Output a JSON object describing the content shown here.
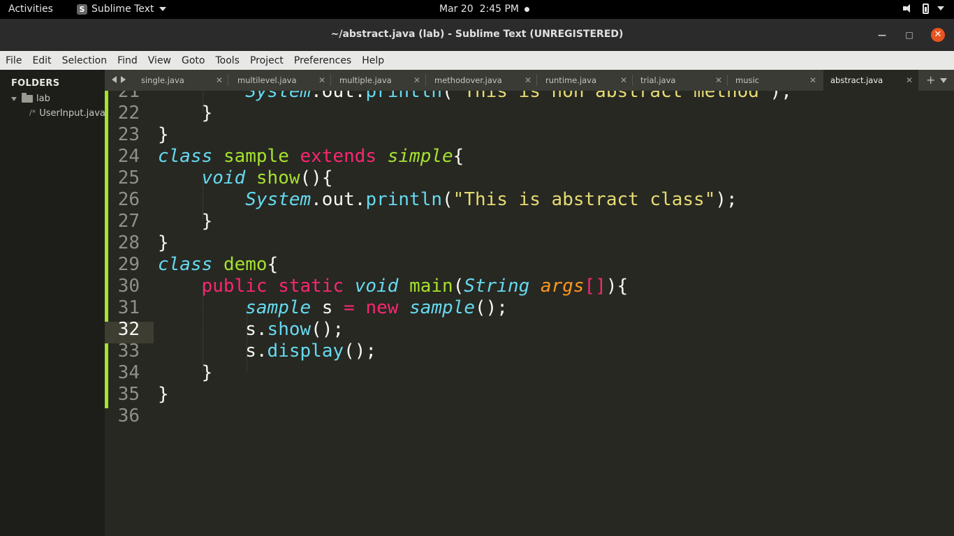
{
  "system": {
    "activities": "Activities",
    "app_name": "Sublime Text",
    "clock": "Mar 20  2:45 PM"
  },
  "window": {
    "title": "~/abstract.java (lab) - Sublime Text (UNREGISTERED)"
  },
  "menu": [
    "File",
    "Edit",
    "Selection",
    "Find",
    "View",
    "Goto",
    "Tools",
    "Project",
    "Preferences",
    "Help"
  ],
  "sidebar": {
    "header": "FOLDERS",
    "folder": "lab",
    "file_icon": "/*",
    "file": "UserInput.java"
  },
  "tabs": [
    {
      "label": "single.java"
    },
    {
      "label": "multilevel.java"
    },
    {
      "label": "multiple.java"
    },
    {
      "label": "methodover.java"
    },
    {
      "label": "runtime.java"
    },
    {
      "label": "trial.java"
    },
    {
      "label": "music"
    },
    {
      "label": "abstract.java",
      "active": true
    }
  ],
  "colors": {
    "background": "#272822",
    "keyword": "#f92672",
    "type": "#66d9ef",
    "class_name": "#a6e22e",
    "string": "#e6db74",
    "param": "#fd971f",
    "modified_marker": "#a6e22e"
  },
  "editor": {
    "current_line": 32,
    "lines": [
      {
        "n": "21",
        "tokens": [
          [
            "        ",
            ""
          ],
          [
            "System",
            "t"
          ],
          [
            ".out.",
            ""
          ],
          [
            "println",
            "f"
          ],
          [
            "(",
            ""
          ],
          [
            "\"This is non abstract method\"",
            "s"
          ],
          [
            ");",
            ""
          ]
        ]
      },
      {
        "n": "22",
        "tokens": [
          [
            "    }",
            ""
          ]
        ]
      },
      {
        "n": "23",
        "tokens": [
          [
            "}",
            ""
          ]
        ]
      },
      {
        "n": "24",
        "tokens": [
          [
            "class",
            "t"
          ],
          [
            " ",
            ""
          ],
          [
            "sample",
            "c"
          ],
          [
            " ",
            ""
          ],
          [
            "extends",
            "k"
          ],
          [
            " ",
            ""
          ],
          [
            "simple",
            "ci"
          ],
          [
            "{",
            ""
          ]
        ]
      },
      {
        "n": "25",
        "tokens": [
          [
            "    ",
            ""
          ],
          [
            "void",
            "t"
          ],
          [
            " ",
            ""
          ],
          [
            "show",
            "c"
          ],
          [
            "(){",
            ""
          ]
        ]
      },
      {
        "n": "26",
        "tokens": [
          [
            "        ",
            ""
          ],
          [
            "System",
            "t"
          ],
          [
            ".out.",
            ""
          ],
          [
            "println",
            "f"
          ],
          [
            "(",
            ""
          ],
          [
            "\"This is abstract class\"",
            "s"
          ],
          [
            ");",
            ""
          ]
        ]
      },
      {
        "n": "27",
        "tokens": [
          [
            "    }",
            ""
          ]
        ]
      },
      {
        "n": "28",
        "tokens": [
          [
            "}",
            ""
          ]
        ]
      },
      {
        "n": "29",
        "tokens": [
          [
            "class",
            "t"
          ],
          [
            " ",
            ""
          ],
          [
            "demo",
            "c"
          ],
          [
            "{",
            ""
          ]
        ]
      },
      {
        "n": "30",
        "tokens": [
          [
            "    ",
            ""
          ],
          [
            "public",
            "k"
          ],
          [
            " ",
            ""
          ],
          [
            "static",
            "k"
          ],
          [
            " ",
            ""
          ],
          [
            "void",
            "t"
          ],
          [
            " ",
            ""
          ],
          [
            "main",
            "c"
          ],
          [
            "(",
            ""
          ],
          [
            "String",
            "t"
          ],
          [
            " ",
            ""
          ],
          [
            "args",
            "p"
          ],
          [
            "[]",
            "k"
          ],
          [
            "){",
            ""
          ]
        ]
      },
      {
        "n": "31",
        "tokens": [
          [
            "        ",
            ""
          ],
          [
            "sample",
            "t"
          ],
          [
            " s ",
            ""
          ],
          [
            "=",
            "k"
          ],
          [
            " ",
            ""
          ],
          [
            "new",
            "k"
          ],
          [
            " ",
            ""
          ],
          [
            "sample",
            "t"
          ],
          [
            "();",
            ""
          ]
        ]
      },
      {
        "n": "32",
        "tokens": [
          [
            "        s.",
            ""
          ],
          [
            "show",
            "f"
          ],
          [
            "();",
            ""
          ]
        ]
      },
      {
        "n": "33",
        "tokens": [
          [
            "        s.",
            ""
          ],
          [
            "display",
            "f"
          ],
          [
            "();",
            ""
          ]
        ]
      },
      {
        "n": "34",
        "tokens": [
          [
            "    }",
            ""
          ]
        ]
      },
      {
        "n": "35",
        "tokens": [
          [
            "}",
            ""
          ]
        ]
      },
      {
        "n": "36",
        "tokens": []
      }
    ]
  }
}
